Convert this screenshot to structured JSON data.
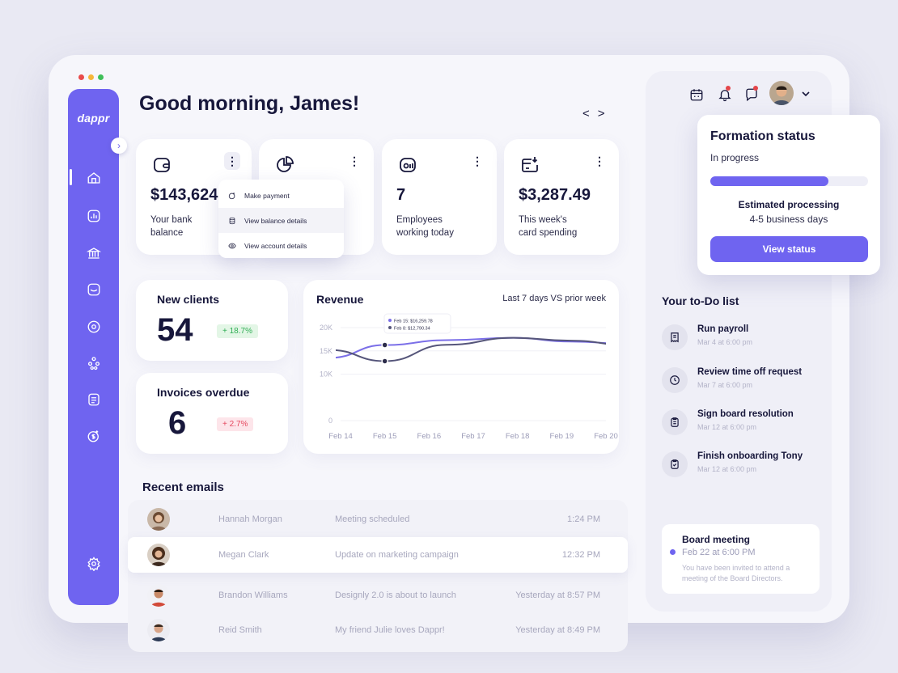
{
  "brand": {
    "name": "dappr",
    "accent": "#6f64f0"
  },
  "window_controls": [
    "#e94b4b",
    "#f5b63a",
    "#3fbf59"
  ],
  "sidebar": {
    "items": [
      {
        "icon": "home-icon"
      },
      {
        "icon": "dashboard-icon"
      },
      {
        "icon": "bank-icon"
      },
      {
        "icon": "inbox-icon"
      },
      {
        "icon": "target-icon"
      },
      {
        "icon": "team-icon"
      },
      {
        "icon": "document-icon"
      },
      {
        "icon": "payment-icon"
      },
      {
        "icon": "settings-icon"
      }
    ]
  },
  "header": {
    "greeting": "Good morning, James!",
    "prev": "<",
    "next": ">"
  },
  "stats": [
    {
      "icon": "wallet-icon",
      "value": "$143,624",
      "label": "Your bank balance"
    },
    {
      "icon": "pie-chart-icon",
      "value": "",
      "label": ""
    },
    {
      "icon": "people-icon",
      "value": "7",
      "label": "Employees working today"
    },
    {
      "icon": "card-spending-icon",
      "value": "$3,287.49",
      "label": "This week's card spending"
    }
  ],
  "dropdown": {
    "items": [
      {
        "label": "Make payment",
        "icon": "payment-icon"
      },
      {
        "label": "View balance details",
        "icon": "database-icon"
      },
      {
        "label": "View account details",
        "icon": "eye-icon"
      }
    ]
  },
  "new_clients": {
    "title": "New clients",
    "value": "54",
    "change": "+ 18.7%",
    "color": "#2fae54"
  },
  "invoices": {
    "title": "Invoices overdue",
    "value": "6",
    "change": "+ 2.7%",
    "color": "#e5485f"
  },
  "revenue": {
    "title": "Revenue",
    "period": "Last 7 days VS prior week",
    "tooltip": {
      "line1": "Feb 15: $16,259.78",
      "line2": "Feb 8: $12,790.34"
    }
  },
  "chart_data": {
    "type": "line",
    "title": "Revenue",
    "x": [
      "Feb 14",
      "Feb 15",
      "Feb 16",
      "Feb 17",
      "Feb 18",
      "Feb 19",
      "Feb 20"
    ],
    "yticks": [
      "0",
      "10K",
      "15K",
      "20K"
    ],
    "ylim": [
      0,
      20000
    ],
    "grid": true,
    "series": [
      {
        "name": "Last 7 days",
        "color": "#7b6fe8",
        "values": [
          13500,
          16260,
          17300,
          17800,
          17000,
          16500,
          17800
        ]
      },
      {
        "name": "Prior week",
        "color": "#55557a",
        "values": [
          15200,
          12790,
          16300,
          17800,
          17200,
          16200,
          15200
        ]
      }
    ],
    "x_range": [
      14,
      20
    ],
    "x_points": [
      13.75,
      15,
      16.4,
      17.9,
      19.2,
      20.55
    ]
  },
  "emails": {
    "title": "Recent emails",
    "rows": [
      {
        "name": "Hannah Morgan",
        "subject": "Meeting scheduled",
        "time": "1:24 PM"
      },
      {
        "name": "Megan Clark",
        "subject": "Update on marketing campaign",
        "time": "12:32 PM"
      },
      {
        "name": "Brandon Williams",
        "subject": "Designly 2.0 is about to launch",
        "time": "Yesterday at 8:57 PM"
      },
      {
        "name": "Reid Smith",
        "subject": "My friend Julie loves Dappr!",
        "time": "Yesterday at 8:49 PM"
      }
    ]
  },
  "formation": {
    "title": "Formation status",
    "status": "In progress",
    "progress": 0.75,
    "estimate_label": "Estimated processing",
    "estimate_value": "4-5 business days",
    "button": "View status"
  },
  "todo": {
    "title": "Your to-Do list",
    "items": [
      {
        "label": "Run payroll",
        "date": "Mar 4 at 6:00 pm",
        "icon": "receipt-icon"
      },
      {
        "label": "Review time off request",
        "date": "Mar 7 at 6:00 pm",
        "icon": "clock-icon"
      },
      {
        "label": "Sign board resolution",
        "date": "Mar 12 at 6:00 pm",
        "icon": "clipboard-icon"
      },
      {
        "label": "Finish onboarding Tony",
        "date": "Mar 12 at 6:00 pm",
        "icon": "clipboard-check-icon"
      }
    ]
  },
  "meeting": {
    "title": "Board meeting",
    "date": "Feb 22 at 6:00 PM",
    "body": "You have been invited to attend a meeting of the Board Directors."
  }
}
